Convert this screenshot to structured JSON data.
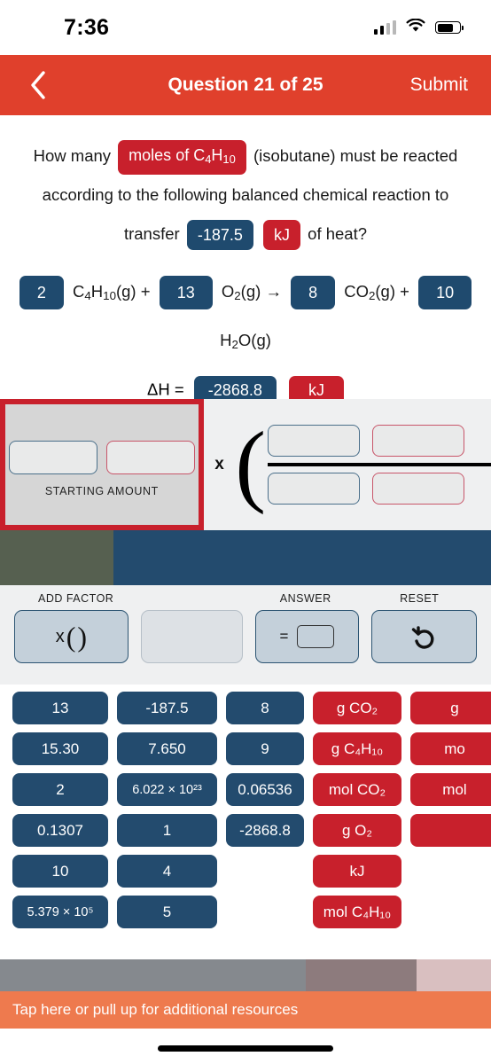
{
  "status_bar": {
    "time": "7:36",
    "signal_icon": "cellular-bars-icon",
    "wifi_icon": "wifi-icon",
    "battery_icon": "battery-icon"
  },
  "header": {
    "back_icon": "back-chevron-icon",
    "title": "Question 21 of 25",
    "submit_label": "Submit",
    "background_color": "#e0402c"
  },
  "question": {
    "part1": "How many",
    "chip_moles": "moles of C₄H₁₀",
    "part2": "(isobutane) must be reacted according to the following balanced chemical reaction to transfer",
    "chip_value": "-187.5",
    "chip_unit": "kJ",
    "part3": "of heat?"
  },
  "equation": {
    "coef_butane": "2",
    "species_butane": "C₄H₁₀(g)",
    "plus1": "+",
    "coef_oxygen": "13",
    "species_oxygen": "O₂(g)",
    "arrow": "→",
    "coef_co2": "8",
    "species_co2": "CO₂(g)",
    "plus2": "+",
    "coef_water": "10",
    "species_water": "H₂O(g)",
    "delta_h_label": "ΔH =",
    "delta_h_value": "-2868.8",
    "delta_h_unit": "kJ"
  },
  "work_area": {
    "starting_amount_label": "STARTING AMOUNT",
    "multiply_symbol": "x",
    "highlight_color": "#c8202c",
    "strip_olive": "#566050",
    "strip_navy": "#234b6e"
  },
  "toolbar": {
    "add_factor_label": "ADD FACTOR",
    "add_factor_symbol": "x",
    "answer_label": "ANSWER",
    "answer_symbol": "=",
    "reset_label": "RESET",
    "reset_icon": "undo-arrow-icon"
  },
  "tiles": {
    "columns": [
      {
        "type": "blue",
        "width_class": "col-w1",
        "items": [
          "13",
          "15.30",
          "2",
          "0.1307",
          "10",
          "5.379 × 10⁵"
        ]
      },
      {
        "type": "blue",
        "width_class": "col-w2",
        "items": [
          "-187.5",
          "7.650",
          "6.022 × 10²³",
          "1",
          "4",
          "5"
        ]
      },
      {
        "type": "blue",
        "width_class": "col-w3",
        "items": [
          "8",
          "9",
          "0.06536",
          "-2868.8"
        ]
      },
      {
        "type": "red",
        "width_class": "col-w4",
        "items": [
          "g CO₂",
          "g C₄H₁₀",
          "mol CO₂",
          "g O₂",
          "kJ",
          "mol C₄H₁₀"
        ]
      },
      {
        "type": "red",
        "width_class": "col-w5",
        "items": [
          "g ",
          "mo",
          "mol",
          ""
        ]
      }
    ]
  },
  "bottom": {
    "resources_text": "Tap here or pull up for additional resources",
    "resources_color": "#ee7a4e",
    "strip_gray": "#85898e",
    "strip_mauve": "#8d7b7d",
    "strip_pink": "#d9bfc0"
  }
}
